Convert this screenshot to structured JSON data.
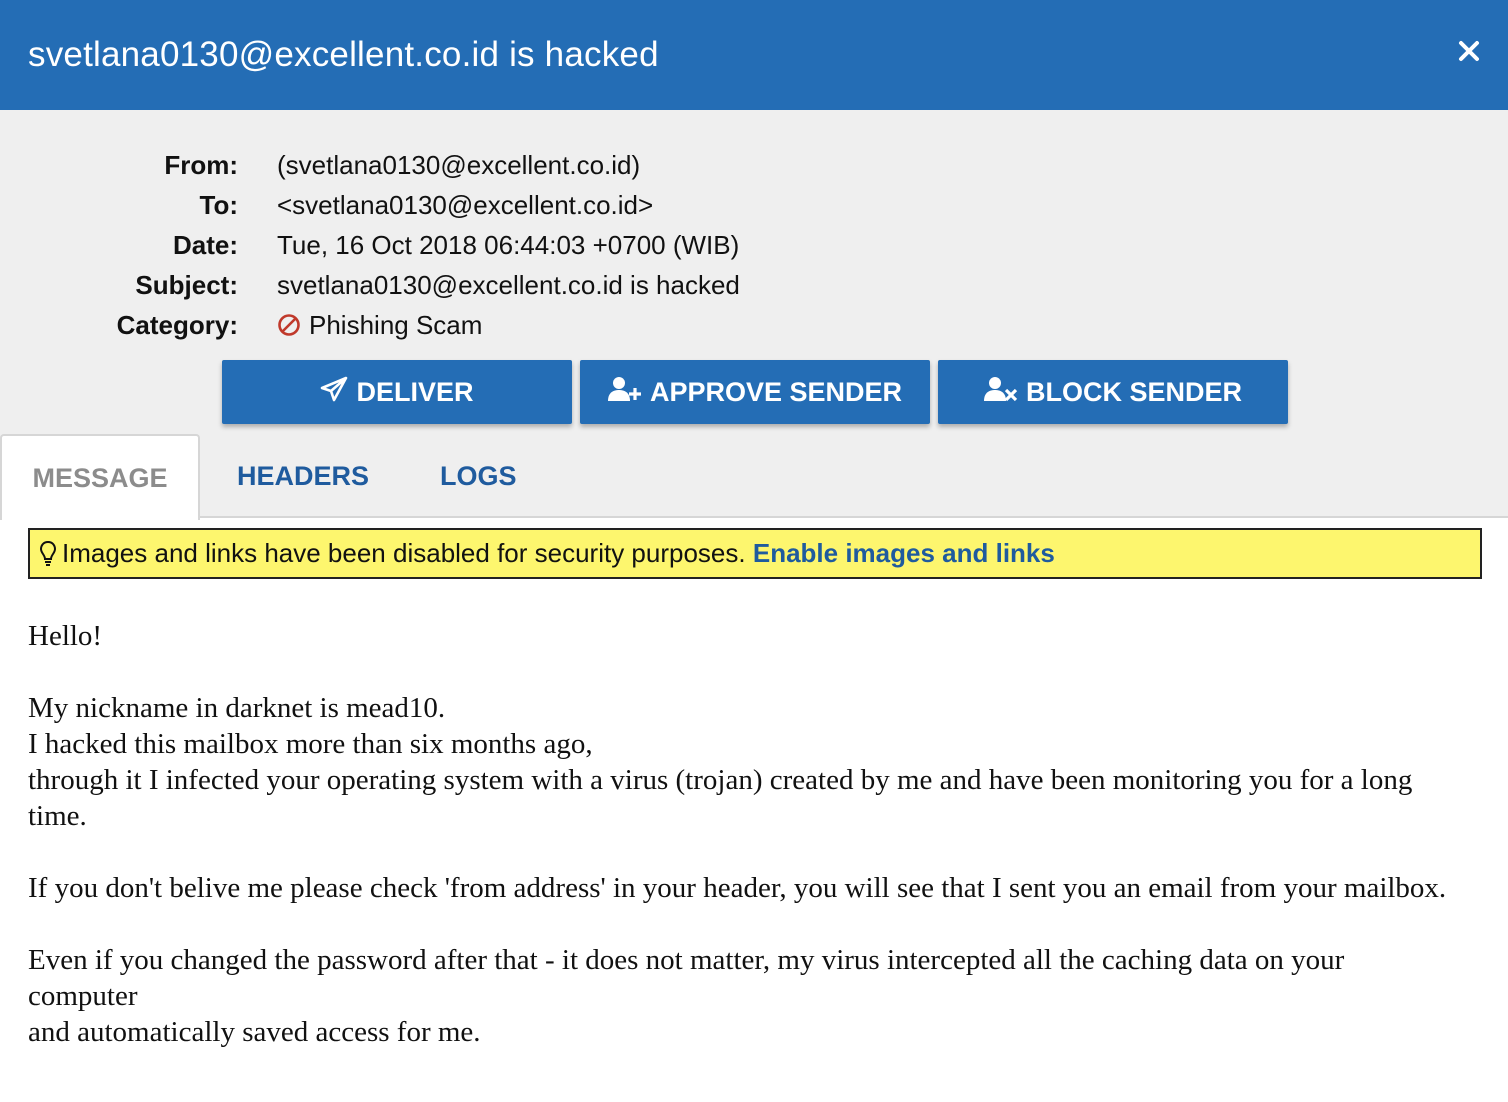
{
  "window": {
    "title": "svetlana0130@excellent.co.id is hacked",
    "close_icon": "close-icon"
  },
  "meta": {
    "rows": [
      {
        "label": "From:",
        "value": "(svetlana0130@excellent.co.id)"
      },
      {
        "label": "To:",
        "value": "<svetlana0130@excellent.co.id>"
      },
      {
        "label": "Date:",
        "value": "Tue, 16 Oct 2018 06:44:03 +0700 (WIB)"
      },
      {
        "label": "Subject:",
        "value": "svetlana0130@excellent.co.id is hacked"
      },
      {
        "label": "Category:",
        "value": "Phishing Scam",
        "icon": "prohibited-icon",
        "icon_color": "#c0392b"
      }
    ]
  },
  "actions": {
    "deliver": {
      "label": "DELIVER",
      "icon": "paper-plane-icon"
    },
    "approve": {
      "label": "APPROVE SENDER",
      "icon": "user-plus-icon"
    },
    "block": {
      "label": "BLOCK SENDER",
      "icon": "user-times-icon"
    }
  },
  "tabs": [
    {
      "label": "MESSAGE",
      "active": true
    },
    {
      "label": "HEADERS",
      "active": false
    },
    {
      "label": "LOGS",
      "active": false
    }
  ],
  "notice": {
    "text": "Images and links have been disabled for security purposes.",
    "link": "Enable images and links",
    "icon": "lightbulb-icon",
    "background": "#fdf66e"
  },
  "message": {
    "paragraphs": [
      "Hello!",
      "My nickname in darknet is mead10.\nI hacked this mailbox more than six months ago,\nthrough it I infected your operating system with a virus (trojan) created by me and have been monitoring you for a long time.",
      "If you don't belive me please check 'from address' in your header, you will see that I sent you an email from your mailbox.",
      "Even if you changed the password after that - it does not matter, my virus intercepted all the caching data on your computer\nand automatically saved access for me."
    ]
  },
  "colors": {
    "accent": "#246db5",
    "link": "#1f5b9e",
    "panel": "#efefef"
  }
}
